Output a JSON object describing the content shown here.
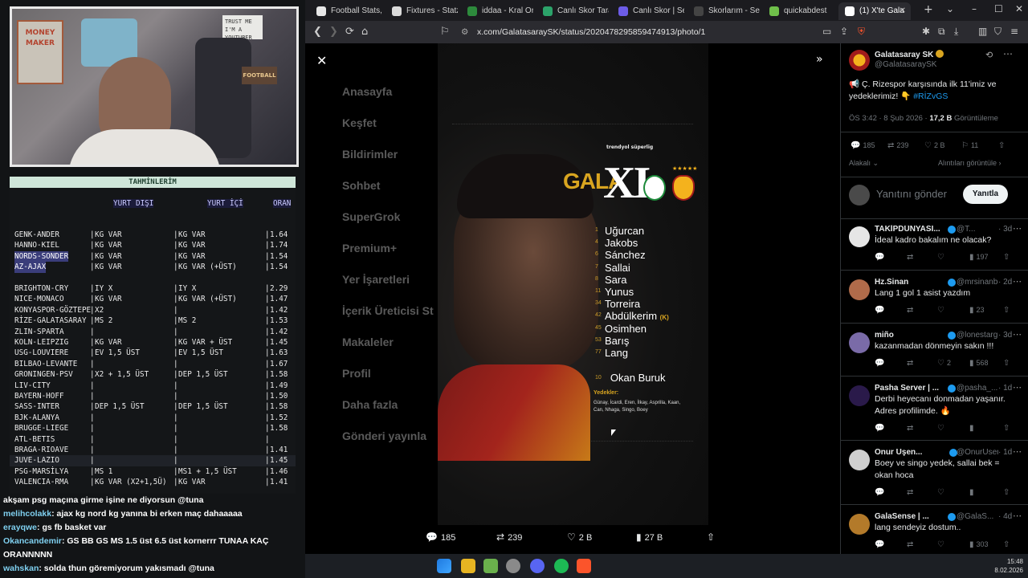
{
  "webcam": {
    "poster": "MONEY MAKER",
    "tee": "TRUST ME I'M A YOUTUBER",
    "sign": "FOOTBALL"
  },
  "tahmin": {
    "title": "TAHMİNLERİM",
    "headers": [
      "YURT DIŞI",
      "YURT İÇİ",
      "ORAN"
    ],
    "rows": [
      {
        "match": "GENK-ANDER",
        "yd": "KG VAR",
        "yi": "KG VAR",
        "oran": "1.64"
      },
      {
        "match": "HANNO-KIEL",
        "yd": "KG VAR",
        "yi": "KG VAR",
        "oran": "1.74"
      },
      {
        "match": "NORDS-SONDER",
        "yd": "KG VAR",
        "yi": "KG VAR",
        "oran": "1.54"
      },
      {
        "match": "AZ-AJAX",
        "yd": "KG VAR",
        "yi": "KG VAR (+ÜST)",
        "oran": "1.54"
      },
      {
        "match": "",
        "yd": "",
        "yi": "",
        "oran": ""
      },
      {
        "match": "BRIGHTON-CRY",
        "yd": "IY X",
        "yi": "IY X",
        "oran": "2.29"
      },
      {
        "match": "NICE-MONACO",
        "yd": "KG VAR",
        "yi": "KG VAR (+ÜST)",
        "oran": "1.47"
      },
      {
        "match": "KONYASPOR-GÖZTEPE",
        "yd": "X2",
        "yi": "",
        "oran": "1.42"
      },
      {
        "match": "RİZE-GALATASARAY",
        "yd": "MS 2",
        "yi": "MS 2",
        "oran": "1.53"
      },
      {
        "match": "ZLIN-SPARTA",
        "yd": "",
        "yi": "",
        "oran": "1.42"
      },
      {
        "match": "KOLN-LEIPZIG",
        "yd": "KG VAR",
        "yi": "KG VAR + ÜST",
        "oran": "1.45"
      },
      {
        "match": "USG-LOUVIERE",
        "yd": "EV 1,5 ÜST",
        "yi": "EV 1,5 ÜST",
        "oran": "1.63"
      },
      {
        "match": "BILBAO-LEVANTE",
        "yd": "",
        "yi": "",
        "oran": "1.67"
      },
      {
        "match": "GRONINGEN-PSV",
        "yd": "X2 + 1,5 ÜST",
        "yi": "DEP 1,5 ÜST",
        "oran": "1.58"
      },
      {
        "match": "LIV-CITY",
        "yd": "",
        "yi": "",
        "oran": "1.49"
      },
      {
        "match": "BAYERN-HOFF",
        "yd": "",
        "yi": "",
        "oran": "1.50"
      },
      {
        "match": "SASS-INTER",
        "yd": "DEP 1,5 ÜST",
        "yi": "DEP 1,5 ÜST",
        "oran": "1.58"
      },
      {
        "match": "BJK-ALANYA",
        "yd": "",
        "yi": "",
        "oran": "1.52"
      },
      {
        "match": "BRUGGE-LIEGE",
        "yd": "",
        "yi": "",
        "oran": "1.58"
      },
      {
        "match": "ATL-BETIS",
        "yd": "",
        "yi": "",
        "oran": ""
      },
      {
        "match": "BRAGA-RIOAVE",
        "yd": "",
        "yi": "",
        "oran": "1.41"
      },
      {
        "match": "JUVE-LAZIO",
        "yd": "",
        "yi": "",
        "oran": "1.45"
      },
      {
        "match": "PSG-MARSİLYA",
        "yd": "MS 1",
        "yi": "MS1 + 1,5 ÜST",
        "oran": "1.46"
      },
      {
        "match": "VALENCIA-RMA",
        "yd": "KG VAR (X2+1,5Ü)",
        "yi": "KG VAR",
        "oran": "1.41"
      }
    ]
  },
  "chat": [
    {
      "user": "",
      "text": "akşam psg maçına girme işine ne diyorsun @tuna"
    },
    {
      "user": "melihcolakk",
      "text": ": ajax kg nord kg yanına bi erken maç dahaaaaa"
    },
    {
      "user": "erayqwe",
      "text": ": gs fb basket var"
    },
    {
      "user": "Okancandemir",
      "text": ": GS BB GS MS 1.5 üst 6.5 üst kornerrr TUNAA KAÇ"
    },
    {
      "user": "",
      "text": "ORANNNNN"
    },
    {
      "user": "wahskan",
      "text": ": solda thun göremiyorum yakısmadı @tuna"
    }
  ],
  "tabs": [
    {
      "label": "Football Stats, Tab",
      "color": "#e7e7e7"
    },
    {
      "label": "Fixtures - Statz",
      "color": "#dadada"
    },
    {
      "label": "iddaa - Kral Oran",
      "color": "#2d8a3c"
    },
    {
      "label": "Canlı Skor Tarayıc",
      "color": "#2ca36a"
    },
    {
      "label": "Canlı Skor | Seçili",
      "color": "#6c5ce7"
    },
    {
      "label": "Skorlarım - Senin",
      "color": "#444"
    },
    {
      "label": "quickabdest",
      "color": "#6fbf4a"
    },
    {
      "label": "(1) X'te Gala",
      "color": "#fff"
    }
  ],
  "url": "x.com/GalatasaraySK/status/2020478295859474913/photo/1",
  "bgnav": [
    "Anasayfa",
    "Keşfet",
    "Bildirimler",
    "Sohbet",
    "SuperGrok",
    "Premium+",
    "Yer İşaretleri",
    "İçerik Üreticisi St",
    "Makaleler",
    "Profil",
    "Daha fazla",
    "Gönderi yayınla"
  ],
  "photo": {
    "brand": "trendyol süperlig",
    "gala": "GALA",
    "xi": "XI",
    "players": [
      {
        "no": "1",
        "name": "Uğurcan"
      },
      {
        "no": "4",
        "name": "Jakobs"
      },
      {
        "no": "6",
        "name": "Sánchez"
      },
      {
        "no": "7",
        "name": "Sallai"
      },
      {
        "no": "8",
        "name": "Sara"
      },
      {
        "no": "11",
        "name": "Yunus"
      },
      {
        "no": "34",
        "name": "Torreira"
      },
      {
        "no": "42",
        "name": "Abdülkerim",
        "cap": "(K)"
      },
      {
        "no": "45",
        "name": "Osimhen"
      },
      {
        "no": "53",
        "name": "Barış"
      },
      {
        "no": "77",
        "name": "Lang"
      }
    ],
    "coach_no": "10",
    "coach": "Okan Buruk",
    "yedekler": "Yedekler:",
    "subs": "Günay, İcardi, Eren, İlkay, Asprilla, Kaan, Can, Nhaga, Singo, Boey"
  },
  "actions": {
    "reply": "185",
    "retweet": "239",
    "like": "2 B",
    "views": "27 B"
  },
  "post": {
    "name": "Galatasaray SK",
    "handle": "@GalatasaraySK",
    "text": "📢 Ç. Rizespor karşısında ilk 11'imiz ve yedeklerimiz! 👇",
    "hashtag": "#RİZvGS",
    "time": "ÖS 3:42 · 8 Şub 2026 · ",
    "views_num": "17,2 B",
    "views_label": " Görüntüleme",
    "reply": "185",
    "rt": "239",
    "like": "2 B",
    "bm": "11",
    "sort": "Alakalı",
    "quotes": "Alıntıları görüntüle",
    "reply_placeholder": "Yanıtını gönder",
    "reply_btn": "Yanıtla"
  },
  "replies": [
    {
      "name": "TAKİPDÜNYASI...",
      "handle": "@T...",
      "time": "· 3d",
      "text": "İdeal kadro bakalım ne olacak?",
      "views": "197",
      "likes": "",
      "color": "#e6e6e6"
    },
    {
      "name": "Hz.Sinan",
      "handle": "@mrsinanbulut",
      "time": "· 2d",
      "text": "Lang 1 gol 1 asist yazdım",
      "views": "23",
      "likes": "",
      "color": "#b06b4a"
    },
    {
      "name": "miño",
      "handle": "@lonestargunnerr",
      "time": "· 3d",
      "text": "kazanmadan dönmeyin sakın !!!",
      "views": "568",
      "likes": "2",
      "color": "#7a6ba8"
    },
    {
      "name": "Pasha Server | ...",
      "handle": "@pasha_...",
      "time": "· 1d",
      "text": "Derbi heyecanı donmadan yaşanır. Adres profilimde. 🔥",
      "views": "",
      "likes": "",
      "color": "#2a1a4a"
    },
    {
      "name": "Onur Uşen...",
      "handle": "@OnurUsen...",
      "time": "· 1d",
      "text": "Boey ve singo yedek,  sallai bek = okan hoca",
      "views": "",
      "likes": "",
      "color": "#cfcfcf"
    },
    {
      "name": "GalaSense | ...",
      "handle": "@GalaS...",
      "time": "· 4d",
      "text": "lang sendeyiz dostum..",
      "views": "303",
      "likes": "",
      "color": "#b37a2a"
    }
  ],
  "tray": {
    "time": "15:48",
    "date": "8.02.2026"
  }
}
